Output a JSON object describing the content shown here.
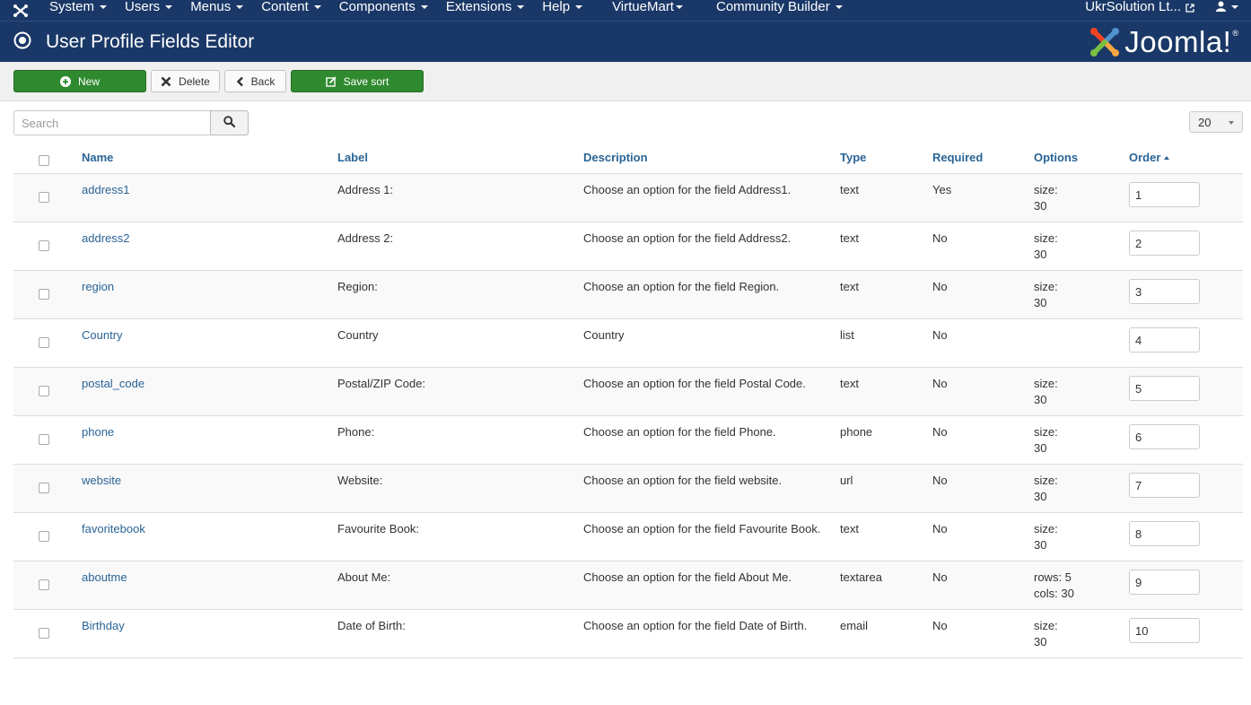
{
  "topnav": {
    "items": [
      {
        "label": "System"
      },
      {
        "label": "Users"
      },
      {
        "label": "Menus"
      },
      {
        "label": "Content"
      },
      {
        "label": "Components"
      },
      {
        "label": "Extensions"
      },
      {
        "label": "Help"
      },
      {
        "label": "VirtueMart"
      },
      {
        "label": "Community Builder"
      }
    ],
    "site_label": "UkrSolution Lt..."
  },
  "title": "User Profile Fields Editor",
  "brand": {
    "word": "Joomla!",
    "reg": "®"
  },
  "toolbar": {
    "new_label": "New",
    "delete_label": "Delete",
    "back_label": "Back",
    "save_sort_label": "Save sort"
  },
  "filters": {
    "search_placeholder": "Search",
    "search_value": "",
    "limit": "20"
  },
  "table": {
    "headers": {
      "name": "Name",
      "label": "Label",
      "description": "Description",
      "type": "Type",
      "required": "Required",
      "options": "Options",
      "order": "Order"
    },
    "rows": [
      {
        "name": "address1",
        "label": "Address 1:",
        "description": "Choose an option for the field Address1.",
        "type": "text",
        "required": "Yes",
        "opt1": "size:",
        "opt2": "30",
        "order": "1"
      },
      {
        "name": "address2",
        "label": "Address 2:",
        "description": "Choose an option for the field Address2.",
        "type": "text",
        "required": "No",
        "opt1": "size:",
        "opt2": "30",
        "order": "2"
      },
      {
        "name": "region",
        "label": "Region:",
        "description": "Choose an option for the field Region.",
        "type": "text",
        "required": "No",
        "opt1": "size:",
        "opt2": "30",
        "order": "3"
      },
      {
        "name": "Country",
        "label": "Country",
        "description": "Country",
        "type": "list",
        "required": "No",
        "opt1": "",
        "opt2": "",
        "order": "4"
      },
      {
        "name": "postal_code",
        "label": "Postal/ZIP Code:",
        "description": "Choose an option for the field Postal Code.",
        "type": "text",
        "required": "No",
        "opt1": "size:",
        "opt2": "30",
        "order": "5"
      },
      {
        "name": "phone",
        "label": "Phone:",
        "description": "Choose an option for the field Phone.",
        "type": "phone",
        "required": "No",
        "opt1": "size:",
        "opt2": "30",
        "order": "6"
      },
      {
        "name": "website",
        "label": "Website:",
        "description": "Choose an option for the field website.",
        "type": "url",
        "required": "No",
        "opt1": "size:",
        "opt2": "30",
        "order": "7"
      },
      {
        "name": "favoritebook",
        "label": "Favourite Book:",
        "description": "Choose an option for the field Favourite Book.",
        "type": "text",
        "required": "No",
        "opt1": "size:",
        "opt2": "30",
        "order": "8"
      },
      {
        "name": "aboutme",
        "label": "About Me:",
        "description": "Choose an option for the field About Me.",
        "type": "textarea",
        "required": "No",
        "opt1": "rows: 5",
        "opt2": "cols: 30",
        "order": "9"
      },
      {
        "name": "Birthday",
        "label": "Date of Birth:",
        "description": "Choose an option for the field Date of Birth.",
        "type": "email",
        "required": "No",
        "opt1": "size:",
        "opt2": "30",
        "order": "10"
      }
    ]
  },
  "colors": {
    "nav_bg": "#1a3867",
    "green_button": "#2f8a2f",
    "link": "#2a6496"
  },
  "icons": [
    "joomla-logo-icon",
    "caret-down-icon",
    "external-link-icon",
    "user-icon",
    "target-icon",
    "plus-circle-icon",
    "times-icon",
    "chevron-left-icon",
    "edit-icon",
    "search-icon",
    "sort-asc-icon"
  ]
}
